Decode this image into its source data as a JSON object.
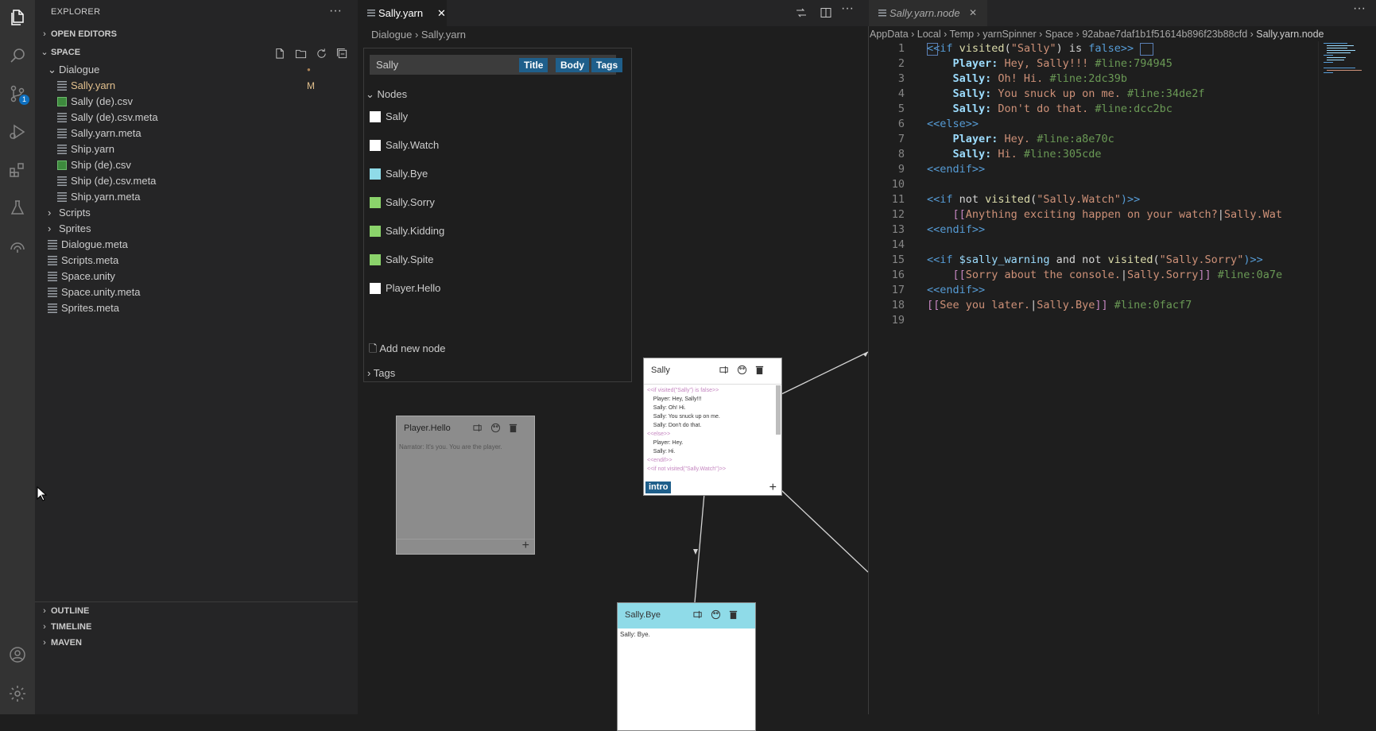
{
  "sidebar": {
    "title": "EXPLORER",
    "open_editors": "OPEN EDITORS",
    "space": "SPACE",
    "tree": [
      {
        "label": "Dialogue",
        "kind": "folder",
        "badge": "●"
      },
      {
        "label": "Sally.yarn",
        "kind": "file",
        "badge": "M"
      },
      {
        "label": "Sally (de).csv",
        "kind": "csv"
      },
      {
        "label": "Sally (de).csv.meta",
        "kind": "file"
      },
      {
        "label": "Sally.yarn.meta",
        "kind": "file"
      },
      {
        "label": "Ship.yarn",
        "kind": "file"
      },
      {
        "label": "Ship (de).csv",
        "kind": "csv"
      },
      {
        "label": "Ship (de).csv.meta",
        "kind": "file"
      },
      {
        "label": "Ship.yarn.meta",
        "kind": "file"
      },
      {
        "label": "Scripts",
        "kind": "folder"
      },
      {
        "label": "Sprites",
        "kind": "folder"
      },
      {
        "label": "Dialogue.meta",
        "kind": "file"
      },
      {
        "label": "Scripts.meta",
        "kind": "file"
      },
      {
        "label": "Space.unity",
        "kind": "file"
      },
      {
        "label": "Space.unity.meta",
        "kind": "file"
      },
      {
        "label": "Sprites.meta",
        "kind": "file"
      }
    ],
    "outline": "OUTLINE",
    "timeline": "TIMELINE",
    "maven": "MAVEN"
  },
  "activity": {
    "scm_badge": "1"
  },
  "editor1": {
    "tab": "Sally.yarn",
    "crumbs": [
      "Dialogue",
      "Sally.yarn"
    ],
    "search_value": "Sally",
    "filters": [
      "Title",
      "Body",
      "Tags"
    ],
    "nodes_header": "Nodes",
    "nodes": [
      {
        "label": "Sally",
        "color": "#ffffff"
      },
      {
        "label": "Sally.Watch",
        "color": "#ffffff"
      },
      {
        "label": "Sally.Bye",
        "color": "#8fdbe8"
      },
      {
        "label": "Sally.Sorry",
        "color": "#8bd36b"
      },
      {
        "label": "Sally.Kidding",
        "color": "#8bd36b"
      },
      {
        "label": "Sally.Spite",
        "color": "#8bd36b"
      },
      {
        "label": "Player.Hello",
        "color": "#ffffff"
      }
    ],
    "add_node": "Add new node",
    "tags_header": "Tags",
    "graph": {
      "sally": {
        "title": "Sally",
        "lines": [
          "<<if visited(\"Sally\") is false>>",
          "    Player: Hey, Sally!!!",
          "    Sally: Oh! Hi.",
          "    Sally: You snuck up on me.",
          "    Sally: Don't do that.",
          "<<else>>",
          "    Player: Hey.",
          "    Sally: Hi.",
          "<<endif>>",
          "<<if not visited(\"Sally.Watch\")>>"
        ],
        "tag": "intro"
      },
      "player_hello": {
        "title": "Player.Hello",
        "body": "Narrator: It's you. You are the player."
      },
      "sally_bye": {
        "title": "Sally.Bye",
        "body": "Sally: Bye."
      }
    }
  },
  "editor2": {
    "tab": "Sally.yarn.node",
    "crumbs": [
      "AppData",
      "Local",
      "Temp",
      "yarnSpinner",
      "Space",
      "92abae7daf1b1f51614b896f23b88cfd",
      "Sally.yarn.node"
    ],
    "code_lines": [
      [
        [
          "<<",
          "c-kw"
        ],
        [
          "if ",
          "c-kw"
        ],
        [
          "visited",
          "c-fn"
        ],
        [
          "(",
          "t"
        ],
        [
          "\"Sally\"",
          "c-str"
        ],
        [
          ") is ",
          "t"
        ],
        [
          "false",
          "c-kw"
        ],
        [
          ">>",
          "c-kw"
        ]
      ],
      [
        [
          "    Player:",
          "c-spk"
        ],
        [
          " Hey, Sally!!! ",
          "c-str"
        ],
        [
          "#line:794945",
          "c-cmt"
        ]
      ],
      [
        [
          "    Sally:",
          "c-spk"
        ],
        [
          " Oh! Hi. ",
          "c-str"
        ],
        [
          "#line:2dc39b",
          "c-cmt"
        ]
      ],
      [
        [
          "    Sally:",
          "c-spk"
        ],
        [
          " You snuck up on me. ",
          "c-str"
        ],
        [
          "#line:34de2f",
          "c-cmt"
        ]
      ],
      [
        [
          "    Sally:",
          "c-spk"
        ],
        [
          " Don't do that. ",
          "c-str"
        ],
        [
          "#line:dcc2bc",
          "c-cmt"
        ]
      ],
      [
        [
          "<<",
          "c-kw"
        ],
        [
          "else",
          "c-kw"
        ],
        [
          ">>",
          "c-kw"
        ]
      ],
      [
        [
          "    Player:",
          "c-spk"
        ],
        [
          " Hey. ",
          "c-str"
        ],
        [
          "#line:a8e70c",
          "c-cmt"
        ]
      ],
      [
        [
          "    Sally:",
          "c-spk"
        ],
        [
          " Hi. ",
          "c-str"
        ],
        [
          "#line:305cde",
          "c-cmt"
        ]
      ],
      [
        [
          "<<",
          "c-kw"
        ],
        [
          "endif",
          "c-kw"
        ],
        [
          ">>",
          "c-kw"
        ]
      ],
      [],
      [
        [
          "<<",
          "c-kw"
        ],
        [
          "if ",
          "c-kw"
        ],
        [
          "not ",
          "t"
        ],
        [
          "visited",
          "c-fn"
        ],
        [
          "(",
          "t"
        ],
        [
          "\"Sally.Watch\"",
          "c-str"
        ],
        [
          ")>>",
          "c-kw"
        ]
      ],
      [
        [
          "    [[",
          "c-opt"
        ],
        [
          "Anything exciting happen on your watch?",
          "c-str"
        ],
        [
          "|",
          "t"
        ],
        [
          "Sally.Wat",
          "c-str"
        ]
      ],
      [
        [
          "<<",
          "c-kw"
        ],
        [
          "endif",
          "c-kw"
        ],
        [
          ">>",
          "c-kw"
        ]
      ],
      [],
      [
        [
          "<<",
          "c-kw"
        ],
        [
          "if ",
          "c-kw"
        ],
        [
          "$sally_warning",
          "c-var"
        ],
        [
          " and not ",
          "t"
        ],
        [
          "visited",
          "c-fn"
        ],
        [
          "(",
          "t"
        ],
        [
          "\"Sally.Sorry\"",
          "c-str"
        ],
        [
          ")>>",
          "c-kw"
        ]
      ],
      [
        [
          "    [[",
          "c-opt"
        ],
        [
          "Sorry about the console.",
          "c-str"
        ],
        [
          "|",
          "t"
        ],
        [
          "Sally.Sorry",
          "c-str"
        ],
        [
          "]] ",
          "c-opt"
        ],
        [
          "#line:0a7e",
          "c-cmt"
        ]
      ],
      [
        [
          "<<",
          "c-kw"
        ],
        [
          "endif",
          "c-kw"
        ],
        [
          ">>",
          "c-kw"
        ]
      ],
      [
        [
          "[[",
          "c-opt"
        ],
        [
          "See you later.",
          "c-str"
        ],
        [
          "|",
          "t"
        ],
        [
          "Sally.Bye",
          "c-str"
        ],
        [
          "]] ",
          "c-opt"
        ],
        [
          "#line:0facf7",
          "c-cmt"
        ]
      ],
      []
    ]
  }
}
